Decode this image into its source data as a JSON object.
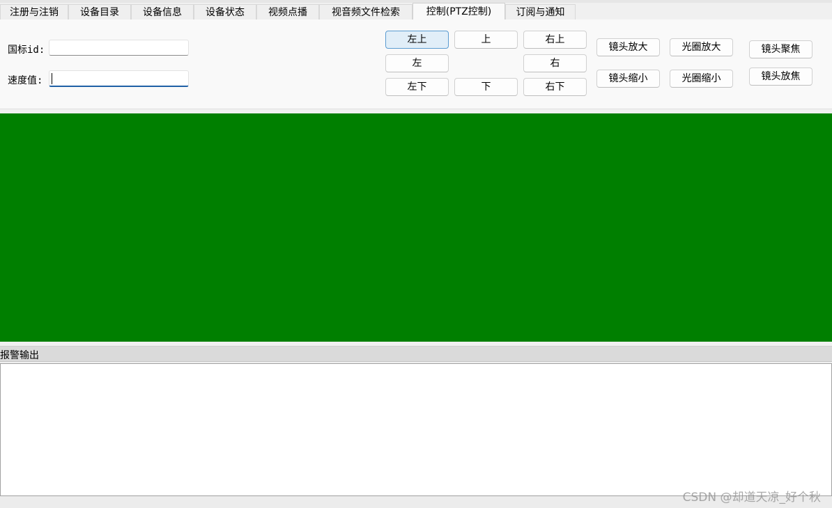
{
  "tabs": [
    {
      "label": "注册与注销"
    },
    {
      "label": "设备目录"
    },
    {
      "label": "设备信息"
    },
    {
      "label": "设备状态"
    },
    {
      "label": "视频点播"
    },
    {
      "label": "视音频文件检索"
    },
    {
      "label": "控制(PTZ控制)",
      "active": true
    },
    {
      "label": "订阅与通知"
    }
  ],
  "form": {
    "gb_id_label": "国标id:",
    "gb_id_value": "",
    "speed_label": "速度值:",
    "speed_value": ""
  },
  "ptz": {
    "up_left": "左上",
    "up": "上",
    "up_right": "右上",
    "left": "左",
    "right": "右",
    "down_left": "左下",
    "down": "下",
    "down_right": "右下"
  },
  "lens": {
    "zoom_in": "镜头放大",
    "zoom_out": "镜头缩小",
    "iris_open": "光圈放大",
    "iris_close": "光圈缩小",
    "focus_near": "镜头聚焦",
    "focus_far": "镜头放焦"
  },
  "video": {
    "background_color": "#007f00"
  },
  "alarm": {
    "title": "报警输出",
    "output_text": ""
  },
  "watermark": "CSDN @却道天凉_好个秋"
}
